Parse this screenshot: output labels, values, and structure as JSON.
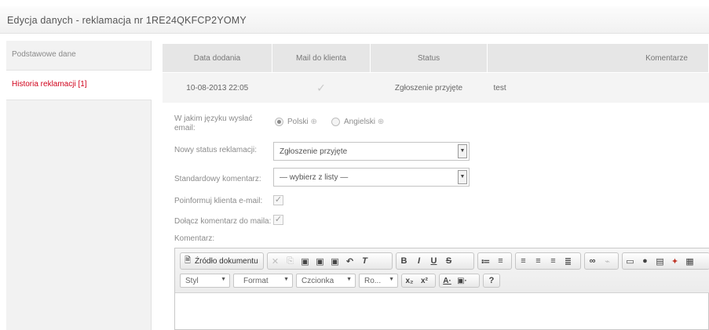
{
  "window": {
    "title": "Edycja danych - reklamacja nr 1RE24QKFCP2YOMY"
  },
  "sidebar": {
    "items": [
      {
        "label": "Podstawowe dane",
        "active": false
      },
      {
        "label": "Historia reklamacji [1]",
        "active": true
      }
    ]
  },
  "history": {
    "headers": [
      "Data dodania",
      "Mail do klienta",
      "Status",
      "Komentarze"
    ],
    "rows": [
      {
        "date": "10-08-2013 22:05",
        "mail": "✓",
        "status": "Zgłoszenie przyjęte",
        "comment": "test"
      }
    ]
  },
  "form": {
    "language_label": "W jakim języku wysłać email:",
    "language_options": [
      "Polski",
      "Angielski"
    ],
    "language_selected": "Polski",
    "status_label": "Nowy status reklamacji:",
    "status_value": "Zgłoszenie przyjęte",
    "std_comment_label": "Standardowy komentarz:",
    "std_comment_value": "— wybierz z listy —",
    "notify_label": "Poinformuj klienta e-mail:",
    "attach_label": "Dołącz komentarz do maila:",
    "comment_label": "Komentarz:"
  },
  "editor": {
    "source_label": "Źródło dokumentu",
    "combos": [
      "Styl",
      "Format",
      "Czcionka",
      "Ro..."
    ],
    "help": "?"
  }
}
